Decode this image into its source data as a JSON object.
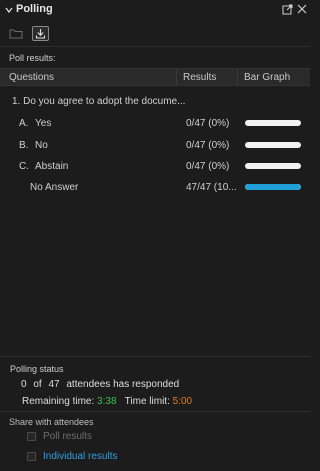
{
  "panel": {
    "title": "Polling"
  },
  "icons": {
    "collapse": "chevron-down-icon",
    "popout": "popout-icon",
    "close": "close-icon",
    "open_folder": "folder-icon",
    "save": "download-icon"
  },
  "colors": {
    "background": "#1c1c1c",
    "bar_track": "#f2f2f2",
    "bar_fill": "#1fa0d8",
    "remaining_time": "#3fbf4f",
    "time_limit": "#e07b1a",
    "link_blue": "#2f9fe0"
  },
  "poll_results": {
    "label": "Poll results:",
    "columns": [
      "Questions",
      "Results",
      "Bar Graph"
    ],
    "question": "1.  Do you agree to adopt the docume...",
    "answers": [
      {
        "letter": "A.",
        "label": "Yes",
        "result": "0/47 (0%)",
        "fraction": 0
      },
      {
        "letter": "B.",
        "label": "No",
        "result": "0/47 (0%)",
        "fraction": 0
      },
      {
        "letter": "C.",
        "label": "Abstain",
        "result": "0/47 (0%)",
        "fraction": 0
      },
      {
        "letter": "",
        "label": "No Answer",
        "result": "47/47 (10...",
        "fraction": 1
      }
    ]
  },
  "status": {
    "label": "Polling status",
    "responded_count": "0",
    "of_word": "of",
    "total": "47",
    "responded_text": "attendees has responded",
    "remaining_label": "Remaining time:",
    "remaining_value": "3:38",
    "limit_label": "Time limit:",
    "limit_value": "5:00"
  },
  "share": {
    "label": "Share with attendees",
    "poll_results": "Poll results",
    "individual_results": "Individual results"
  }
}
